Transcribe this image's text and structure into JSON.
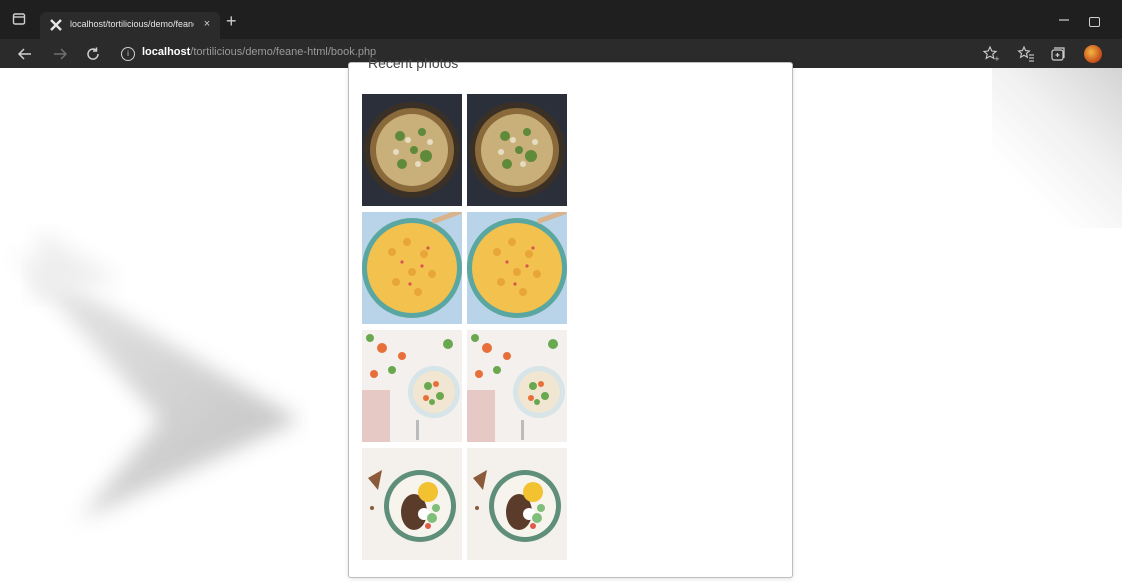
{
  "browser": {
    "tab_title": "localhost/tortilicious/demo/feane",
    "tab_close": "×",
    "new_tab": "+",
    "url_host": "localhost",
    "url_path": "/tortilicious/demo/feane-html/book.php",
    "icons": [
      "window-icon",
      "tab-favicon-icon",
      "close-icon",
      "new-tab-icon",
      "minimize-icon",
      "maximize-icon",
      "back-icon",
      "forward-icon",
      "refresh-icon",
      "info-icon",
      "add-favorite-icon",
      "favorites-icon",
      "collections-icon",
      "profile-avatar"
    ]
  },
  "page": {
    "heading": "Recent photos",
    "photos": [
      {
        "dish": "mushroom frittata skillet",
        "palette": [
          "#2b2f3a",
          "#6a5a3a",
          "#8a9a4a",
          "#d8c89a"
        ]
      },
      {
        "dish": "mushroom frittata skillet",
        "palette": [
          "#2b2f3a",
          "#6a5a3a",
          "#8a9a4a",
          "#d8c89a"
        ]
      },
      {
        "dish": "pasta shells bowl",
        "palette": [
          "#b9d4e8",
          "#f2c14e",
          "#e8a53a",
          "#5aa6a0"
        ]
      },
      {
        "dish": "pasta shells bowl",
        "palette": [
          "#b9d4e8",
          "#f2c14e",
          "#e8a53a",
          "#5aa6a0"
        ]
      },
      {
        "dish": "salad with vegetables",
        "palette": [
          "#f3f0ee",
          "#e76f3a",
          "#6aa84f",
          "#d9b38c"
        ]
      },
      {
        "dish": "salad with vegetables",
        "palette": [
          "#f3f0ee",
          "#e76f3a",
          "#6aa84f",
          "#d9b38c"
        ]
      },
      {
        "dish": "meatloaf plate with egg",
        "palette": [
          "#f4f1ec",
          "#f2c230",
          "#5b3b2a",
          "#7fbf7a"
        ]
      },
      {
        "dish": "meatloaf plate with egg",
        "palette": [
          "#f4f1ec",
          "#f2c230",
          "#5b3b2a",
          "#7fbf7a"
        ]
      }
    ]
  },
  "colors": {
    "titlebar": "#1f1f1f",
    "toolbar": "#2b2b2b",
    "card_border": "#bdbdbd"
  }
}
